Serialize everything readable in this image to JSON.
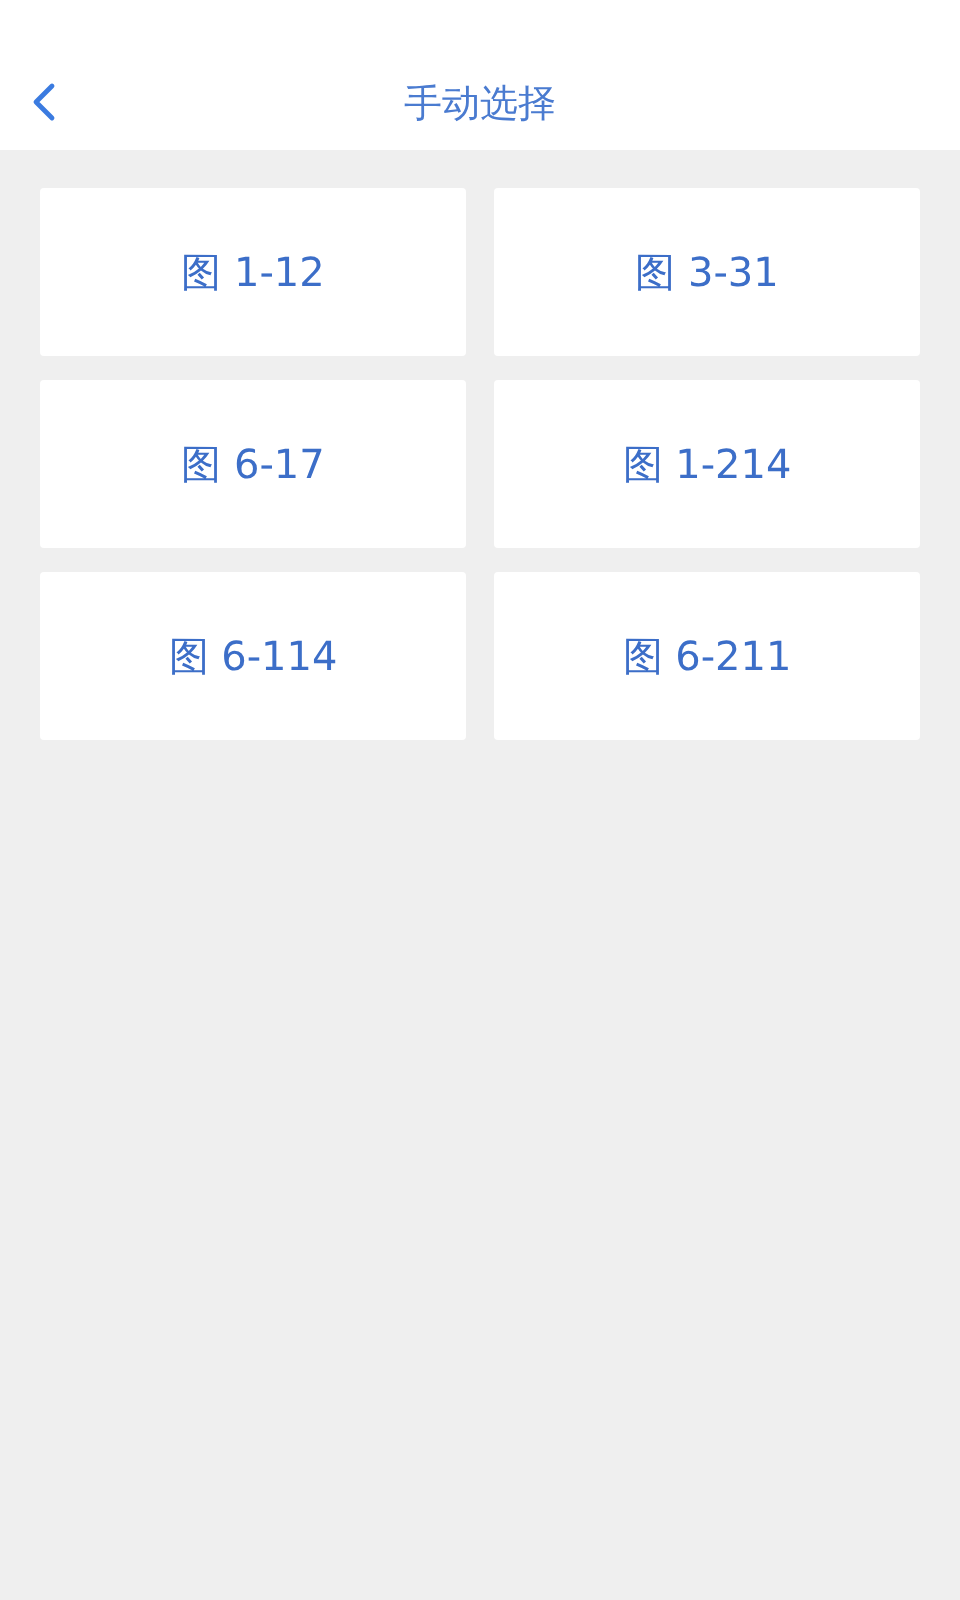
{
  "header": {
    "title": "手动选择"
  },
  "figures": [
    {
      "label": "图 1-12"
    },
    {
      "label": "图 3-31"
    },
    {
      "label": "图 6-17"
    },
    {
      "label": "图 1-214"
    },
    {
      "label": "图 6-114"
    },
    {
      "label": "图 6-211"
    }
  ]
}
